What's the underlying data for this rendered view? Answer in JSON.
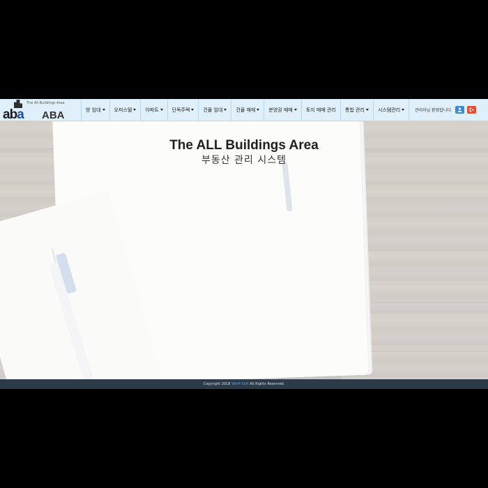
{
  "logo": {
    "tagline": "The All Buildings Area",
    "mark_a1": "ab",
    "mark_a2": "a",
    "short": "ABA"
  },
  "nav": {
    "items": [
      {
        "label": "방 임대",
        "dropdown": true
      },
      {
        "label": "오피스텔",
        "dropdown": true
      },
      {
        "label": "아파트",
        "dropdown": true
      },
      {
        "label": "단독주택",
        "dropdown": true
      },
      {
        "label": "건물 임대",
        "dropdown": true
      },
      {
        "label": "건물 매매",
        "dropdown": true
      },
      {
        "label": "분양권 매매",
        "dropdown": true
      },
      {
        "label": "토지 매매 관리",
        "dropdown": false
      },
      {
        "label": "통합 관리",
        "dropdown": true
      },
      {
        "label": "시스템관리",
        "dropdown": true
      }
    ],
    "welcome": "관리자님 환영합니다.",
    "user_icon": "user-profile-icon",
    "logout_icon": "logout-icon"
  },
  "hero": {
    "title": "The ALL Buildings Area",
    "subtitle": "부동산 관리 시스템"
  },
  "footer": {
    "prefix": "Copyright 2018",
    "brand": "WinP Soft",
    "suffix": "All Rights Reserved."
  },
  "colors": {
    "navbar": "#dff0fa",
    "footer": "#2d3a48",
    "user_button": "#3b8ad6",
    "logout_button": "#e05038"
  }
}
